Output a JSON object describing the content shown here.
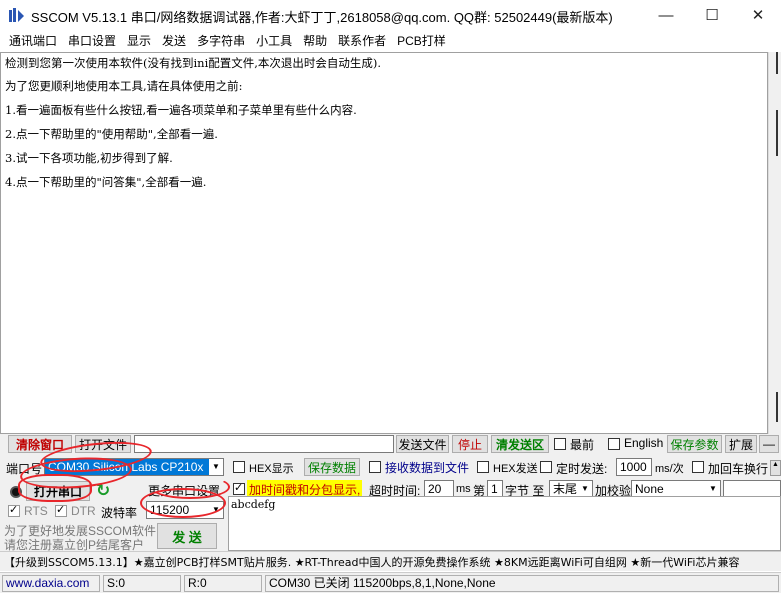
{
  "window": {
    "title": "SSCOM V5.13.1 串口/网络数据调试器,作者:大虾丁丁,2618058@qq.com. QQ群: 52502449(最新版本)",
    "controls": [
      "—",
      "☐",
      "✕"
    ]
  },
  "menu": [
    "通讯端口",
    "串口设置",
    "显示",
    "发送",
    "多字符串",
    "小工具",
    "帮助",
    "联系作者",
    "PCB打样"
  ],
  "receive": {
    "lines": [
      "检测到您第一次使用本软件(没有找到ini配置文件,本次退出时会自动生成).",
      "为了您更顺利地使用本工具,请在具体使用之前:",
      "1.看一遍面板有些什么按钮,看一遍各项菜单和子菜单里有些什么内容.",
      "2.点一下帮助里的\"使用帮助\",全部看一遍.",
      "3.试一下各项功能,初步得到了解.",
      "4.点一下帮助里的\"问答集\",全部看一遍."
    ]
  },
  "toolbar": {
    "clear": "清除窗口",
    "open_file": "打开文件",
    "send_file": "发送文件",
    "stop": "停止",
    "clear_send": "清发送区",
    "topmost": "最前",
    "english": "English",
    "save_params": "保存参数",
    "expand": "扩展",
    "collapse": "—"
  },
  "port": {
    "port_label": "端口号",
    "port_value": "COM30 Silicon Labs CP210x",
    "open_button": "打开串口",
    "more_settings": "更多串口设置",
    "rts": "RTS",
    "dtr": "DTR",
    "baud_label": "波特率",
    "baud_value": "115200",
    "promo1": "为了更好地发展SSCOM软件",
    "promo2": "请您注册嘉立创P结尾客户"
  },
  "options": {
    "hex_display": "HEX显示",
    "save_data": "保存数据",
    "recv_to_file": "接收数据到文件",
    "hex_send": "HEX发送",
    "timed_send": "定时发送:",
    "timed_value": "1000",
    "timed_unit": "ms/次",
    "add_crlf": "加回车换行",
    "timestamp": "加时间戳和分包显示,",
    "timeout_label": "超时时间:",
    "timeout_value": "20",
    "timeout_unit": "ms",
    "nth_label": "第",
    "nth_value": "1",
    "byte_label": "字节 至",
    "end_value": "末尾",
    "checksum_label": "加校验",
    "checksum_value": "None"
  },
  "send": {
    "text": "abcdefg",
    "button": "发 送"
  },
  "ticker": "【升级到SSCOM5.13.1】★嘉立创PCB打样SMT贴片服务. ★RT-Thread中国人的开源免费操作系统 ★8KM远距离WiFi可自组网 ★新一代WiFi芯片兼容",
  "status": {
    "site": "www.daxia.com",
    "sent": "S:0",
    "recv": "R:0",
    "port_state": "COM30 已关闭  115200bps,8,1,None,None"
  },
  "colors": {
    "accent_red": "#e8262b",
    "dark_red": "#c00000",
    "green_text": "#008000",
    "yellow_hl": "#ffff00"
  }
}
